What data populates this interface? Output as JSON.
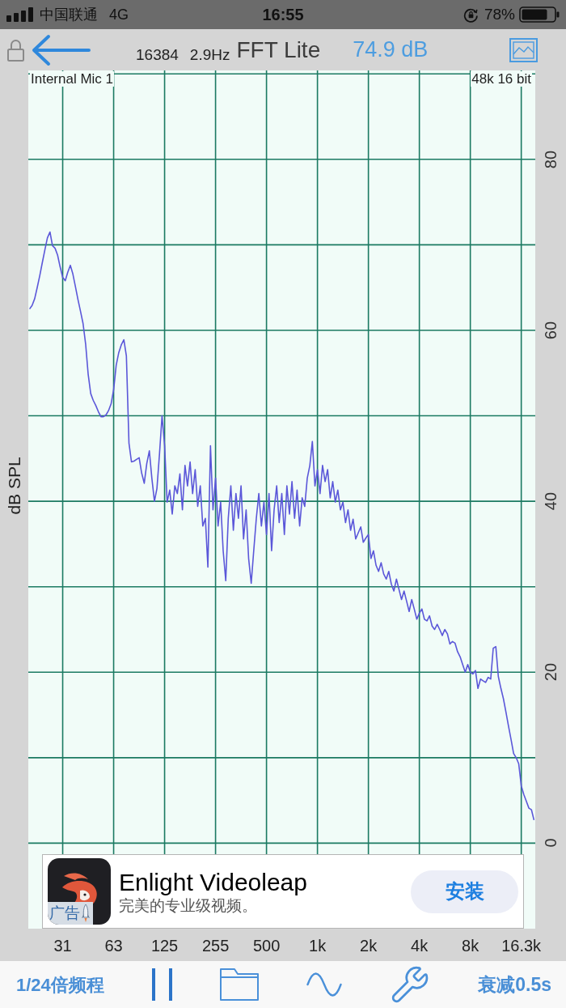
{
  "status_bar": {
    "carrier": "中国联通",
    "network": "4G",
    "time": "16:55",
    "battery": "78%"
  },
  "header": {
    "fft_size": "16384",
    "resolution": "2.9Hz",
    "title": "FFT Lite",
    "reading": "74.9 dB"
  },
  "plot": {
    "input": "Internal Mic 1",
    "format": "48k 16 bit",
    "chart_data": {
      "type": "line",
      "ylabel": "dB SPL",
      "grid": true,
      "ylim": [
        -10,
        90.4
      ],
      "yticks": [
        0,
        20,
        40,
        60,
        80
      ],
      "categories": [
        null,
        null,
        null,
        null,
        null,
        null,
        null,
        null,
        null,
        null,
        null,
        null,
        null,
        "31",
        null,
        null,
        null,
        null,
        null,
        null,
        null,
        null,
        null,
        null,
        null,
        null,
        null,
        null,
        null,
        null,
        null,
        null,
        null,
        "63",
        null,
        null,
        null,
        null,
        null,
        null,
        null,
        null,
        null,
        null,
        null,
        null,
        null,
        null,
        null,
        null,
        null,
        null,
        null,
        "125",
        null,
        null,
        null,
        null,
        null,
        null,
        null,
        null,
        null,
        null,
        null,
        null,
        null,
        null,
        null,
        null,
        null,
        null,
        null,
        "255",
        null,
        null,
        null,
        null,
        null,
        null,
        null,
        null,
        null,
        null,
        null,
        null,
        null,
        null,
        null,
        null,
        null,
        null,
        null,
        "500",
        null,
        null,
        null,
        null,
        null,
        null,
        null,
        null,
        null,
        null,
        null,
        null,
        null,
        null,
        null,
        null,
        null,
        null,
        null,
        "1k",
        null,
        null,
        null,
        null,
        null,
        null,
        null,
        null,
        null,
        null,
        null,
        null,
        null,
        null,
        null,
        null,
        null,
        null,
        null,
        "2k",
        null,
        null,
        null,
        null,
        null,
        null,
        null,
        null,
        null,
        null,
        null,
        null,
        null,
        null,
        null,
        null,
        null,
        null,
        null,
        "4k",
        null,
        null,
        null,
        null,
        null,
        null,
        null,
        null,
        null,
        null,
        null,
        null,
        null,
        null,
        null,
        null,
        null,
        null,
        null,
        "8k",
        null,
        null,
        null,
        null,
        null,
        null,
        null,
        null,
        null,
        null,
        null,
        null,
        null,
        null,
        null,
        null,
        null,
        null,
        null,
        "16.3k",
        null,
        null,
        null,
        null,
        null
      ],
      "series": [
        {
          "color": "#5b57d9",
          "values": [
            62.5,
            62.9,
            63.7,
            65.0,
            66.4,
            67.9,
            69.4,
            70.8,
            71.5,
            69.9,
            69.6,
            68.8,
            67.4,
            66.2,
            65.8,
            66.8,
            67.6,
            66.6,
            65.1,
            63.6,
            62.2,
            60.8,
            58.4,
            54.9,
            52.6,
            51.8,
            51.2,
            50.5,
            49.9,
            49.9,
            50.1,
            50.6,
            51.4,
            53.1,
            55.9,
            57.4,
            58.3,
            58.9,
            57.0,
            46.8,
            44.6,
            44.7,
            44.9,
            45.1,
            43.3,
            42.1,
            44.4,
            45.9,
            42.7,
            40.0,
            41.5,
            45.6,
            50.0,
            46.5,
            39.9,
            41.3,
            38.5,
            41.8,
            40.9,
            43.2,
            39.0,
            44.2,
            41.8,
            44.6,
            40.9,
            43.7,
            39.4,
            41.8,
            37.1,
            38.0,
            32.3,
            46.5,
            39.0,
            42.7,
            37.1,
            39.9,
            34.2,
            30.7,
            38.0,
            41.8,
            36.6,
            40.9,
            38.0,
            41.8,
            35.6,
            39.0,
            33.3,
            30.4,
            34.2,
            38.0,
            40.9,
            37.1,
            39.9,
            36.1,
            40.9,
            34.2,
            39.0,
            41.8,
            37.5,
            40.9,
            36.1,
            41.8,
            38.5,
            42.3,
            38.0,
            41.3,
            37.1,
            40.4,
            39.4,
            42.7,
            44.2,
            47.0,
            41.8,
            43.7,
            40.9,
            44.2,
            42.3,
            43.7,
            40.4,
            42.3,
            39.9,
            41.3,
            39.0,
            39.9,
            37.5,
            39.0,
            36.6,
            37.9,
            35.6,
            36.3,
            37.0,
            35.2,
            35.7,
            36.1,
            33.3,
            34.2,
            32.5,
            31.8,
            32.8,
            31.5,
            30.9,
            31.8,
            30.3,
            29.5,
            30.9,
            29.7,
            28.5,
            29.5,
            28.3,
            27.1,
            28.5,
            27.4,
            26.2,
            26.9,
            27.4,
            26.2,
            26.0,
            26.6,
            25.4,
            25.0,
            25.6,
            25.0,
            24.3,
            25.0,
            24.5,
            23.3,
            23.6,
            23.4,
            22.4,
            21.8,
            20.9,
            20.0,
            20.9,
            20.0,
            19.8,
            20.2,
            18.1,
            19.2,
            19.0,
            18.8,
            19.4,
            19.2,
            22.8,
            23.0,
            19.5,
            18.1,
            16.9,
            15.3,
            13.7,
            12.1,
            10.5,
            10.0,
            9.3,
            6.7,
            5.7,
            4.9,
            4.1,
            3.9,
            2.7
          ]
        }
      ]
    }
  },
  "ad": {
    "badge": "广告",
    "app_name": "Enlight Videoleap",
    "tagline": "完美的专业级视频。",
    "button": "安装"
  },
  "toolbar": {
    "bands": "1/24倍频程",
    "decay": "衰减0.5s"
  }
}
